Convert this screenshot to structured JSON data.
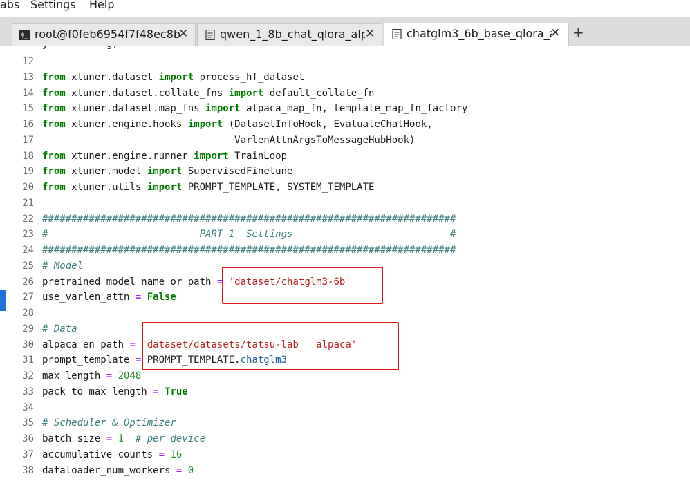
{
  "menu": {
    "tabs_label": "abs",
    "settings_label": "Settings",
    "help_label": "Help"
  },
  "tabs": [
    {
      "label": "root@f0feb6954f7f48ec8b",
      "icon": "terminal-icon"
    },
    {
      "label": "qwen_1_8b_chat_qlora_alp",
      "icon": "document-icon"
    },
    {
      "label": "chatglm3_6b_base_qlora_a",
      "icon": "document-icon"
    }
  ],
  "new_tab": "+",
  "close_glyph": "✕",
  "colors": {
    "keyword": "#007a00",
    "operator": "#aa22ff",
    "string": "#ba2121",
    "comment": "#408080",
    "highlight_box": "#e8141b"
  },
  "code": {
    "partial_line": "y          g,",
    "lines": [
      {
        "n": "12",
        "t": []
      },
      {
        "n": "13",
        "t": [
          [
            "kw",
            "from"
          ],
          [
            "plain",
            " xtuner.dataset "
          ],
          [
            "kw",
            "import"
          ],
          [
            "plain",
            " process_hf_dataset"
          ]
        ]
      },
      {
        "n": "14",
        "t": [
          [
            "kw",
            "from"
          ],
          [
            "plain",
            " xtuner.dataset.collate_fns "
          ],
          [
            "kw",
            "import"
          ],
          [
            "plain",
            " default_collate_fn"
          ]
        ]
      },
      {
        "n": "15",
        "t": [
          [
            "kw",
            "from"
          ],
          [
            "plain",
            " xtuner.dataset.map_fns "
          ],
          [
            "kw",
            "import"
          ],
          [
            "plain",
            " alpaca_map_fn, template_map_fn_factory"
          ]
        ]
      },
      {
        "n": "16",
        "t": [
          [
            "kw",
            "from"
          ],
          [
            "plain",
            " xtuner.engine.hooks "
          ],
          [
            "kw",
            "import"
          ],
          [
            "plain",
            " (DatasetInfoHook, EvaluateChatHook,"
          ]
        ]
      },
      {
        "n": "17",
        "t": [
          [
            "plain",
            "                                 VarlenAttnArgsToMessageHubHook)"
          ]
        ]
      },
      {
        "n": "18",
        "t": [
          [
            "kw",
            "from"
          ],
          [
            "plain",
            " xtuner.engine.runner "
          ],
          [
            "kw",
            "import"
          ],
          [
            "plain",
            " TrainLoop"
          ]
        ]
      },
      {
        "n": "19",
        "t": [
          [
            "kw",
            "from"
          ],
          [
            "plain",
            " xtuner.model "
          ],
          [
            "kw",
            "import"
          ],
          [
            "plain",
            " SupervisedFinetune"
          ]
        ]
      },
      {
        "n": "20",
        "t": [
          [
            "kw",
            "from"
          ],
          [
            "plain",
            " xtuner.utils "
          ],
          [
            "kw",
            "import"
          ],
          [
            "plain",
            " PROMPT_TEMPLATE, SYSTEM_TEMPLATE"
          ]
        ]
      },
      {
        "n": "21",
        "t": []
      },
      {
        "n": "22",
        "t": [
          [
            "com",
            "#######################################################################"
          ]
        ]
      },
      {
        "n": "23",
        "t": [
          [
            "com",
            "#                          PART 1  Settings                           #"
          ]
        ]
      },
      {
        "n": "24",
        "t": [
          [
            "com",
            "#######################################################################"
          ]
        ]
      },
      {
        "n": "25",
        "t": [
          [
            "com",
            "# Model"
          ]
        ]
      },
      {
        "n": "26",
        "t": [
          [
            "plain",
            "pretrained_model_name_or_path "
          ],
          [
            "op",
            "="
          ],
          [
            "plain",
            " "
          ],
          [
            "str",
            "'dataset/chatglm3-6b'"
          ]
        ]
      },
      {
        "n": "27",
        "t": [
          [
            "plain",
            "use_varlen_attn "
          ],
          [
            "op",
            "="
          ],
          [
            "plain",
            " "
          ],
          [
            "kw",
            "False"
          ]
        ]
      },
      {
        "n": "28",
        "t": []
      },
      {
        "n": "29",
        "t": [
          [
            "com",
            "# Data"
          ]
        ]
      },
      {
        "n": "30",
        "t": [
          [
            "plain",
            "alpaca_en_path "
          ],
          [
            "op",
            "="
          ],
          [
            "plain",
            " "
          ],
          [
            "str",
            "'dataset/datasets/tatsu-lab___alpaca'"
          ]
        ]
      },
      {
        "n": "31",
        "t": [
          [
            "plain",
            "prompt_template "
          ],
          [
            "op",
            "="
          ],
          [
            "plain",
            " PROMPT_TEMPLATE."
          ],
          [
            "attr",
            "chatglm3"
          ]
        ]
      },
      {
        "n": "32",
        "t": [
          [
            "plain",
            "max_length "
          ],
          [
            "op",
            "="
          ],
          [
            "plain",
            " "
          ],
          [
            "num",
            "2048"
          ]
        ]
      },
      {
        "n": "33",
        "t": [
          [
            "plain",
            "pack_to_max_length "
          ],
          [
            "op",
            "="
          ],
          [
            "plain",
            " "
          ],
          [
            "kw",
            "True"
          ]
        ]
      },
      {
        "n": "34",
        "t": []
      },
      {
        "n": "35",
        "t": [
          [
            "com",
            "# Scheduler & Optimizer"
          ]
        ]
      },
      {
        "n": "36",
        "t": [
          [
            "plain",
            "batch_size "
          ],
          [
            "op",
            "="
          ],
          [
            "plain",
            " "
          ],
          [
            "num",
            "1"
          ],
          [
            "plain",
            "  "
          ],
          [
            "com",
            "# per_device"
          ]
        ]
      },
      {
        "n": "37",
        "t": [
          [
            "plain",
            "accumulative_counts "
          ],
          [
            "op",
            "="
          ],
          [
            "plain",
            " "
          ],
          [
            "num",
            "16"
          ]
        ]
      },
      {
        "n": "38",
        "t": [
          [
            "plain",
            "dataloader_num_workers "
          ],
          [
            "op",
            "="
          ],
          [
            "plain",
            " "
          ],
          [
            "num",
            "0"
          ]
        ]
      }
    ]
  }
}
